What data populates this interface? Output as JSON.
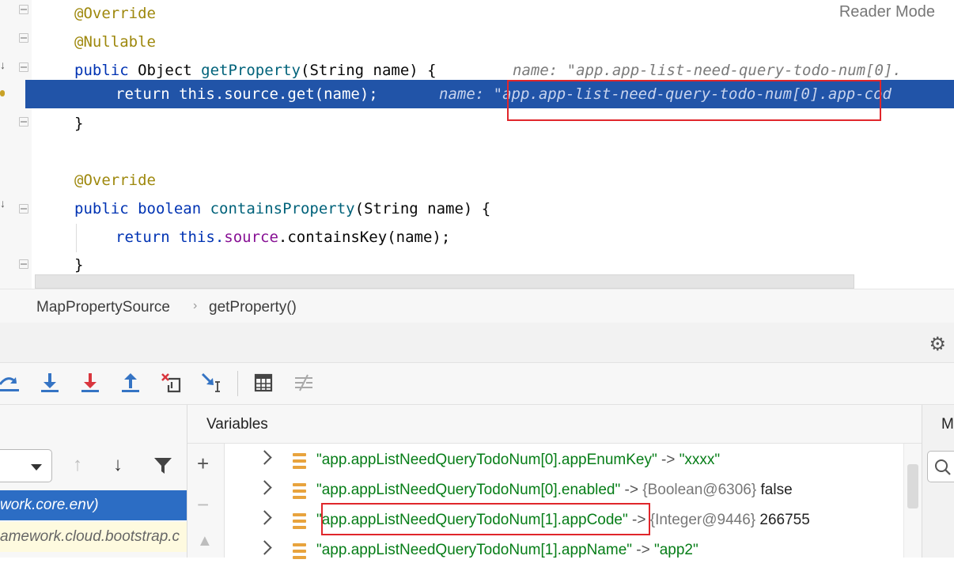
{
  "editor": {
    "reader_mode": "Reader Mode",
    "lines": {
      "l1": "@Override",
      "l2": "@Nullable",
      "l3_kw": "public",
      "l3_type": " Object ",
      "l3_fn": "getProperty",
      "l3_rest": "(String name) {",
      "l3_hint": "name: \"app.app-list-need-query-todo-num[0].",
      "l4_kw": "return",
      "l4_this": " this",
      "l4_rest": ".source.get(name);",
      "l4_hint": "name: \"app.app-list-need-query-todo-num[0].app-cod",
      "l5": "}",
      "l6": "@Override",
      "l7_kw": "public boolean",
      "l7_fn": " containsProperty",
      "l7_rest": "(String name) {",
      "l8_kw": "return",
      "l8_this": " this.",
      "l8_fld": "source",
      "l8_rest": ".containsKey(name);",
      "l9": "}"
    }
  },
  "breadcrumb": {
    "class_name": "MapPropertySource",
    "method_name": "getProperty()"
  },
  "frames": {
    "items": [
      {
        "label": "work.core.env)"
      },
      {
        "label": "amework.cloud.bootstrap.c"
      }
    ]
  },
  "variables": {
    "title": "Variables",
    "rows": [
      {
        "key": "\"app.appListNeedQueryTodoNum[0].appEnumKey\"",
        "arrow": " -> ",
        "type": "",
        "value": "\"xxxx\""
      },
      {
        "key": "\"app.appListNeedQueryTodoNum[0].enabled\"",
        "arrow": " -> ",
        "type": "{Boolean@6306}",
        "value": " false"
      },
      {
        "key": "\"app.appListNeedQueryTodoNum[1].appCode\"",
        "arrow": " -> ",
        "type": "{Integer@9446}",
        "value": " 266755"
      },
      {
        "key": "\"app.appListNeedQueryTodoNum[1].appName\"",
        "arrow": " -> ",
        "type": "",
        "value": "\"app2\""
      }
    ]
  },
  "right_panel": {
    "tab_label": "M"
  },
  "icons": {
    "settings": "gear-icon",
    "step_over": "step-over-icon",
    "step_into": "step-into-icon",
    "force_step_into": "force-step-into-icon",
    "step_out": "step-out-icon",
    "drop_frame": "drop-frame-icon",
    "run_to_cursor": "run-to-cursor-icon",
    "evaluate": "calculator-icon",
    "trace": "trace-icon"
  },
  "colors": {
    "selection": "#2154a8",
    "keyword": "#0033b3",
    "string": "#067d17",
    "annotation": "#9e880d",
    "highlight_box": "#e0262b"
  }
}
